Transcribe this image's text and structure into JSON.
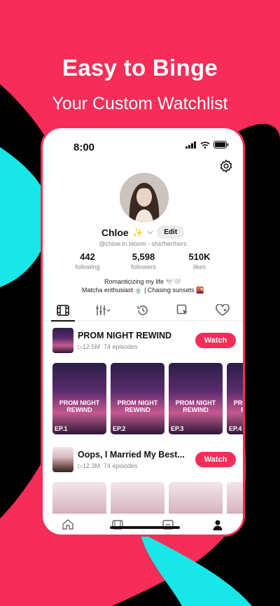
{
  "promo": {
    "headline": "Easy to Binge",
    "subheadline": "Your Custom Watchlist"
  },
  "colors": {
    "accent": "#f52d58",
    "cyan": "#19e6e6",
    "black": "#000000"
  },
  "status_bar": {
    "time": "8:00"
  },
  "profile": {
    "name": "Chloe",
    "name_emoji": "✨",
    "edit_label": "Edit",
    "handle": "@chloe.in.bloom · she/her/hers",
    "stats": [
      {
        "value": "442",
        "label": "following"
      },
      {
        "value": "5,598",
        "label": "followers"
      },
      {
        "value": "510K",
        "label": "likes"
      }
    ],
    "bio_line1": "Romanticizing my life 🕊️🤍",
    "bio_line2": "Matcha enthusiast 🍵 | Chasing sunsets 🌇"
  },
  "tabs": [
    {
      "icon": "film-icon",
      "active": true
    },
    {
      "icon": "sliders-icon",
      "active": false
    },
    {
      "icon": "history-icon",
      "active": false
    },
    {
      "icon": "bookmark-tap-icon",
      "active": false
    },
    {
      "icon": "heart-icon",
      "active": false
    }
  ],
  "shows": [
    {
      "title": "PROM NIGHT REWIND",
      "views": "12.5M",
      "episodes": "74 episodes",
      "watch_label": "Watch",
      "cover_text": "PROM NIGHT REWIND",
      "episode_cards": [
        "EP.1",
        "EP.2",
        "EP.3",
        "EP.4"
      ]
    },
    {
      "title": "Oops, I Married My Best...",
      "views": "12.3M",
      "episodes": "74 episodes",
      "watch_label": "Watch",
      "cover_text": ""
    }
  ]
}
